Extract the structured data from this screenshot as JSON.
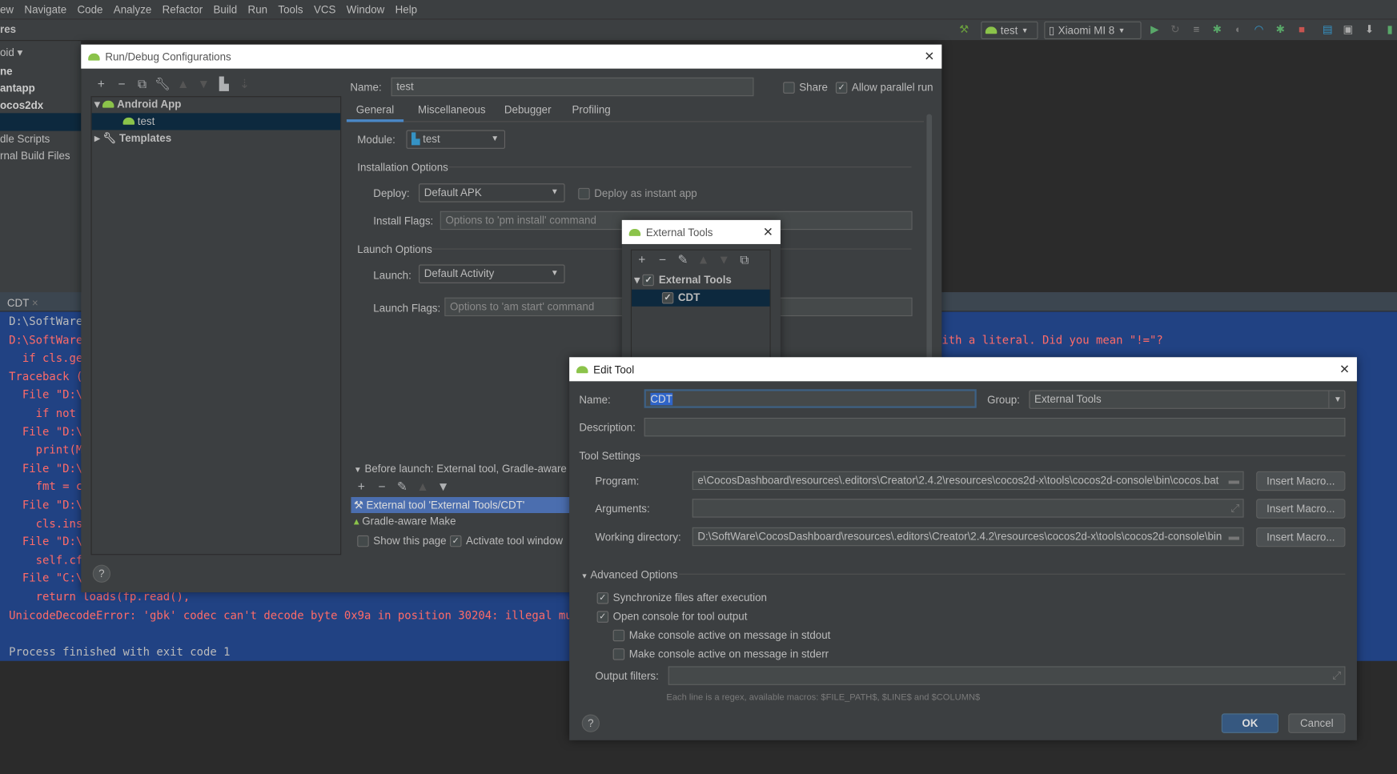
{
  "menu": [
    "ew",
    "Navigate",
    "Code",
    "Analyze",
    "Refactor",
    "Build",
    "Run",
    "Tools",
    "VCS",
    "Window",
    "Help"
  ],
  "toolbar": {
    "config": "test",
    "device": "Xiaomi MI 8"
  },
  "project_panel": {
    "title": "res",
    "dropdown": "oid",
    "items": [
      "ne",
      "antapp",
      "ocos2dx",
      "dle Scripts",
      "rnal Build Files"
    ]
  },
  "console": {
    "tab": "CDT",
    "lines": [
      "D:\\SoftWare",
      "D:\\SoftWare",
      "  if cls.ge",
      "Traceback (m",
      "  File \"D:\\",
      "    if not ",
      "  File \"D:\\",
      "    print(M",
      "  File \"D:\\",
      "    fmt = c",
      "  File \"D:\\",
      "    cls.ins",
      "  File \"D:\\",
      "    self.cf",
      "  File \"C:\\",
      "    return loads(fp.read(),",
      "UnicodeDecodeError: 'gbk' codec can't decode byte 0x9a in position 30204: illegal multib",
      "",
      "Process finished with exit code 1"
    ],
    "right_fragment": "ith a literal. Did you mean \"!=\"?"
  },
  "run_debug": {
    "title": "Run/Debug Configurations",
    "tree": {
      "android_app": "Android App",
      "test": "test",
      "templates": "Templates"
    },
    "name_label": "Name:",
    "name_value": "test",
    "share": "Share",
    "share_checked": false,
    "parallel": "Allow parallel run",
    "parallel_checked": true,
    "tabs": [
      "General",
      "Miscellaneous",
      "Debugger",
      "Profiling"
    ],
    "active_tab": "General",
    "module_label": "Module:",
    "module_value": "test",
    "installation_options": "Installation Options",
    "deploy_label": "Deploy:",
    "deploy_value": "Default APK",
    "instant_app": "Deploy as instant app",
    "install_flags_label": "Install Flags:",
    "install_flags_placeholder": "Options to 'pm install' command",
    "launch_options": "Launch Options",
    "launch_label": "Launch:",
    "launch_value": "Default Activity",
    "launch_flags_label": "Launch Flags:",
    "launch_flags_placeholder": "Options to 'am start' command",
    "before_launch": "Before launch: External tool, Gradle-aware Make",
    "before_items": [
      "External tool 'External Tools/CDT'",
      "Gradle-aware Make"
    ],
    "show_page": "Show this page",
    "show_page_checked": false,
    "activate_tool": "Activate tool window",
    "activate_tool_checked": true,
    "help": "?"
  },
  "external_tools": {
    "title": "External Tools",
    "group": "External Tools",
    "item": "CDT"
  },
  "edit_tool": {
    "title": "Edit Tool",
    "name_label": "Name:",
    "name_value": "CDT",
    "group_label": "Group:",
    "group_value": "External Tools",
    "description_label": "Description:",
    "description_value": "",
    "tool_settings": "Tool Settings",
    "program_label": "Program:",
    "program_value": "e\\CocosDashboard\\resources\\.editors\\Creator\\2.4.2\\resources\\cocos2d-x\\tools\\cocos2d-console\\bin\\cocos.bat",
    "arguments_label": "Arguments:",
    "arguments_value": "",
    "workdir_label": "Working directory:",
    "workdir_value": "D:\\SoftWare\\CocosDashboard\\resources\\.editors\\Creator\\2.4.2\\resources\\cocos2d-x\\tools\\cocos2d-console\\bin",
    "insert_macro": "Insert Macro...",
    "advanced": "Advanced Options",
    "sync": "Synchronize files after execution",
    "sync_checked": true,
    "open_console": "Open console for tool output",
    "open_console_checked": true,
    "stdout": "Make console active on message in stdout",
    "stdout_checked": false,
    "stderr": "Make console active on message in stderr",
    "stderr_checked": false,
    "output_filters_label": "Output filters:",
    "output_filters_value": "",
    "hint": "Each line is a regex, available macros: $FILE_PATH$, $LINE$ and $COLUMN$",
    "ok": "OK",
    "cancel": "Cancel",
    "help": "?"
  },
  "colors": {
    "console_bg": "#214283",
    "error_text": "#ff6b68",
    "dialog_bg": "#3c3f41",
    "selection": "#0d293e",
    "list_selection": "#4b6eaf",
    "ok_button": "#365880",
    "android_green": "#8bc34a"
  }
}
